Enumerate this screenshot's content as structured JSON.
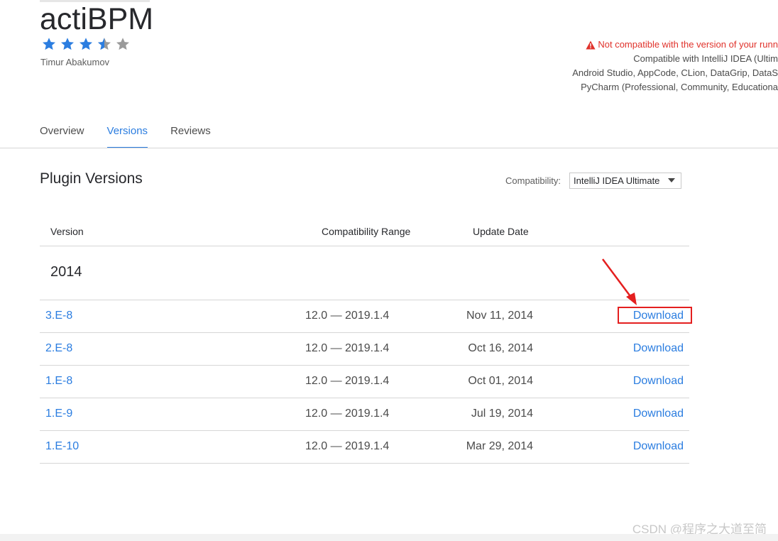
{
  "plugin": {
    "title": "actiBPM",
    "vendor": "Timur Abakumov",
    "rating": 3.5
  },
  "compatibility_notice": {
    "warning": "Not compatible with the version of your runn",
    "lines": [
      "Compatible with IntelliJ IDEA (Ultim",
      "Android Studio, AppCode, CLion, DataGrip, DataS",
      "PyCharm (Professional, Community, Educationa"
    ]
  },
  "tabs": [
    {
      "label": "Overview",
      "active": false
    },
    {
      "label": "Versions",
      "active": true
    },
    {
      "label": "Reviews",
      "active": false
    }
  ],
  "section_title": "Plugin Versions",
  "filter": {
    "label": "Compatibility:",
    "selected": "IntelliJ IDEA Ultimate"
  },
  "table": {
    "headers": {
      "version": "Version",
      "range": "Compatibility Range",
      "date": "Update Date"
    },
    "year": "2014",
    "rows": [
      {
        "version": "3.E-8",
        "range": "12.0 — 2019.1.4",
        "date": "Nov 11, 2014",
        "action": "Download"
      },
      {
        "version": "2.E-8",
        "range": "12.0 — 2019.1.4",
        "date": "Oct 16, 2014",
        "action": "Download"
      },
      {
        "version": "1.E-8",
        "range": "12.0 — 2019.1.4",
        "date": "Oct 01, 2014",
        "action": "Download"
      },
      {
        "version": "1.E-9",
        "range": "12.0 — 2019.1.4",
        "date": "Jul 19, 2014",
        "action": "Download"
      },
      {
        "version": "1.E-10",
        "range": "12.0 — 2019.1.4",
        "date": "Mar 29, 2014",
        "action": "Download"
      }
    ]
  },
  "watermark": "CSDN @程序之大道至简",
  "colors": {
    "accent": "#2b7de0",
    "warning": "#e0322b",
    "annotation": "#e41f1f",
    "star_filled": "#2b7de0",
    "star_empty": "#9a9a9a"
  }
}
